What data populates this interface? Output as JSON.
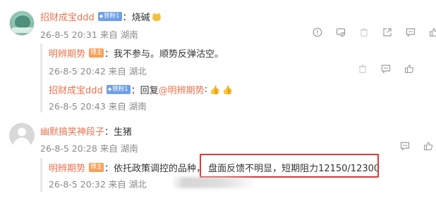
{
  "comments": [
    {
      "username": "招财成宝ddd",
      "fan_badge": "铁粉1",
      "sep": "：",
      "text": "烧碱",
      "meta": "26-8-5 20:31 来自 湖南",
      "replies": [
        {
          "username": "明辨期势",
          "badge": "博主",
          "sep": "：",
          "text": "我不参与。顺势反弹沽空。",
          "meta": "26-8-5 20:42 来自 湖北"
        },
        {
          "username": "招财成宝ddd",
          "fan_badge": "铁粉1",
          "sep": "：",
          "prefix": "回复",
          "mention": "@明辨期势",
          "sep2": ":",
          "meta": "26-8-5 20:43 来自 湖南"
        }
      ]
    },
    {
      "username": "幽默搞笑神段子",
      "sep": "：",
      "text": "生猪",
      "meta": "26-8-5 20:28 来自 湖南",
      "replies": [
        {
          "username": "明辨期势",
          "badge": "博主",
          "sep": "：",
          "text_a": "依托政策调控的品种，",
          "text_b": "盘面反馈不明显，短期阻力12150/12300",
          "meta": "26-8-5 20:32 来自 湖北"
        }
      ]
    }
  ],
  "icons": {
    "report": "report-icon",
    "block": "block-icon",
    "delete": "delete-icon",
    "share": "share-icon",
    "comment": "comment-icon",
    "like": "like-icon"
  },
  "colors": {
    "username": "#eb7350",
    "meta": "#8a8a8a",
    "fan_badge": "#6f9fe8",
    "blogger_badge": "#f5a05a",
    "highlight_border": "#d93a3a"
  }
}
